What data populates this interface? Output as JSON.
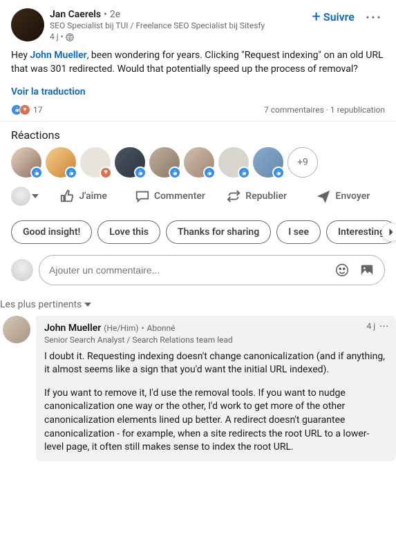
{
  "post": {
    "author_name": "Jan Caerels",
    "degree": "2e",
    "headline": "SEO Specialist bij TUI / Freelance SEO Specialist bij Sitesfy",
    "time": "4 j",
    "follow_label": "Suivre",
    "body_pre": "Hey ",
    "mention": "John Mueller",
    "body_post": ", been wondering for years. Clicking \"Request indexing\" on an old URL that was 301 redirected. Would that potentially speed up the process of removal?",
    "translate": "Voir la traduction"
  },
  "social": {
    "reaction_count": "17",
    "comments": "7 commentaires",
    "reposts": "1 republication"
  },
  "reactions": {
    "title": "Réactions",
    "more": "+9"
  },
  "actions": {
    "like": "J'aime",
    "comment": "Commenter",
    "repost": "Republier",
    "send": "Envoyer"
  },
  "suggestions": [
    "Good insight!",
    "Love this",
    "Thanks for sharing",
    "I see",
    "Interesting"
  ],
  "comment_input": {
    "placeholder": "Ajouter un commentaire..."
  },
  "sort": "Les plus pertinents",
  "comment": {
    "name": "John Mueller",
    "pronouns": "(He/Him)",
    "relation": "Abonné",
    "headline": "Senior Search Analyst / Search Relations team lead",
    "time": "4 j",
    "p1": "I doubt it. Requesting indexing doesn't change canonicalization (and if anything, it almost seems like a sign that you'd want the initial URL indexed).",
    "p2": "If you want to remove it, I'd use the removal tools. If you want to nudge canonicalization one way or the other, I'd work to get more of the other canonicalization elements lined up better. A redirect doesn't guarantee canonicalization - for example, when a site redirects the root URL to a lower-level page, it often still makes sense to index the root URL."
  }
}
